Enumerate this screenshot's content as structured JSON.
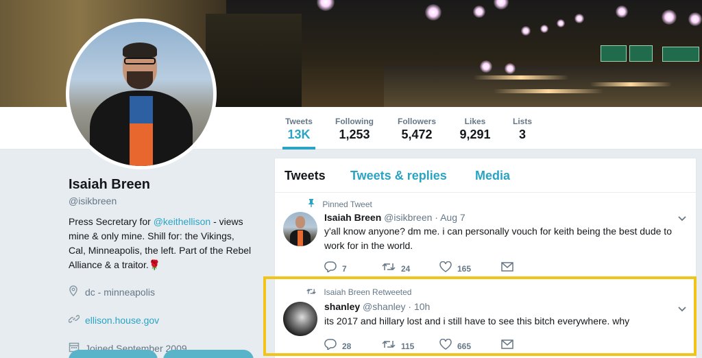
{
  "profile": {
    "name": "Isaiah Breen",
    "handle": "@isikbreen",
    "bio_prefix": "Press Secretary for ",
    "bio_mention": "@keithellison",
    "bio_suffix": " - views mine & only mine. Shill for: the Vikings, Cal, Minneapolis, the left. Part of the Rebel Alliance & a traitor.",
    "bio_emoji": "🌹",
    "location": "dc - minneapolis",
    "website": "ellison.house.gov",
    "joined": "Joined September 2009",
    "location_icon": "location-pin-icon",
    "link_icon": "link-icon",
    "calendar_icon": "calendar-icon"
  },
  "stats": [
    {
      "label": "Tweets",
      "value": "13K",
      "active": true
    },
    {
      "label": "Following",
      "value": "1,253"
    },
    {
      "label": "Followers",
      "value": "5,472"
    },
    {
      "label": "Likes",
      "value": "9,291"
    },
    {
      "label": "Lists",
      "value": "3"
    }
  ],
  "tabs": [
    {
      "label": "Tweets",
      "active": true
    },
    {
      "label": "Tweets & replies"
    },
    {
      "label": "Media"
    }
  ],
  "tweets": [
    {
      "context": "Pinned Tweet",
      "context_icon": "pin-icon",
      "name": "Isaiah Breen",
      "handle_time": "@isikbreen · Aug 7",
      "text": "y'all know anyone? dm me. i can personally vouch for keith being the best dude to work for in the world.",
      "replies": "7",
      "retweets": "24",
      "likes": "165"
    },
    {
      "context": "Isaiah Breen Retweeted",
      "context_icon": "retweet-icon",
      "name": "shanley",
      "handle_time": "@shanley · 10h",
      "text": "its 2017 and hillary lost and i still have to see this bitch everywhere. why",
      "replies": "28",
      "retweets": "115",
      "likes": "665"
    }
  ],
  "icons": {
    "reply": "reply-icon",
    "retweet": "retweet-icon",
    "like": "heart-icon",
    "dm": "mail-icon",
    "caret": "chevron-down-icon"
  },
  "colors": {
    "accent": "#2aa3c4",
    "highlight": "#f2c318",
    "background": "#e6ecf0"
  }
}
